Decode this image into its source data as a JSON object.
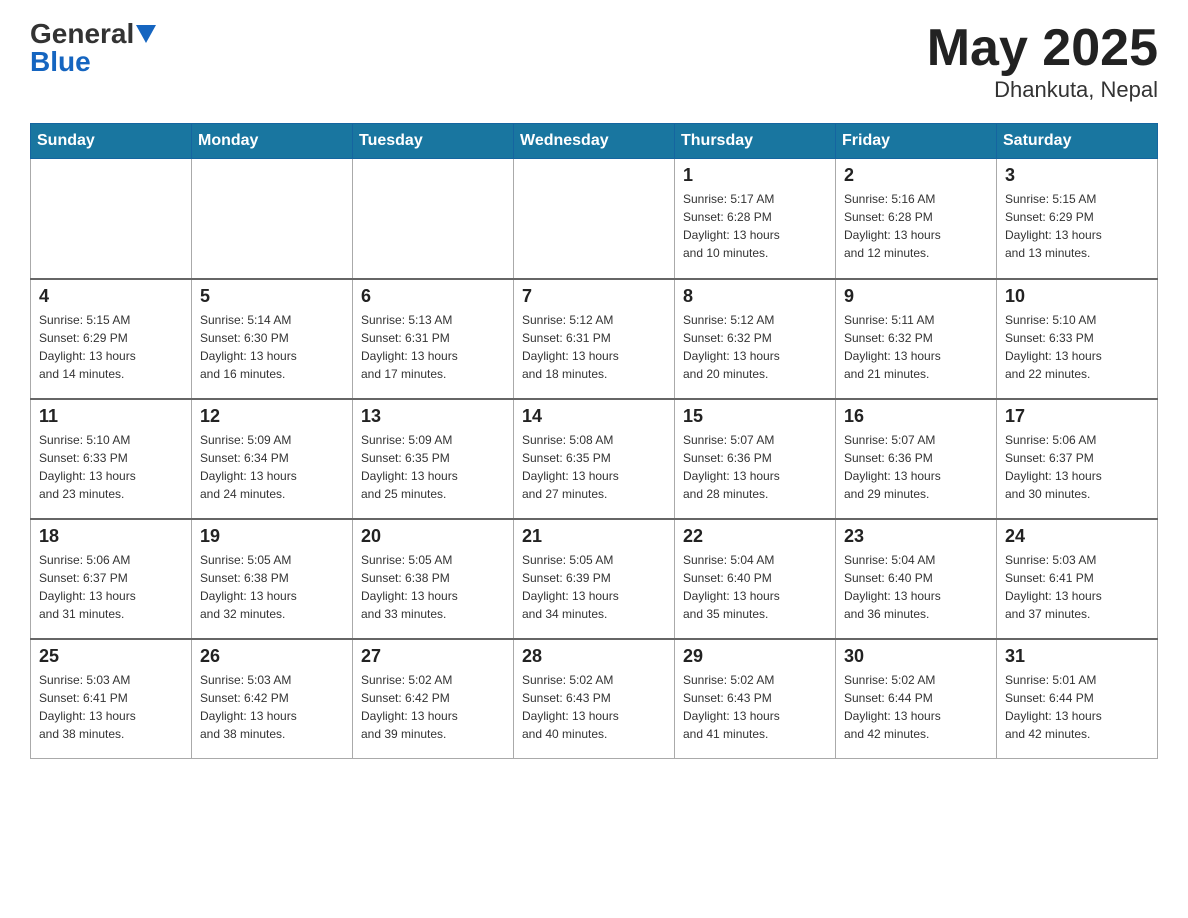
{
  "header": {
    "logo_general": "General",
    "logo_blue": "Blue",
    "month_year": "May 2025",
    "location": "Dhankuta, Nepal"
  },
  "weekdays": [
    "Sunday",
    "Monday",
    "Tuesday",
    "Wednesday",
    "Thursday",
    "Friday",
    "Saturday"
  ],
  "weeks": [
    [
      {
        "day": "",
        "info": ""
      },
      {
        "day": "",
        "info": ""
      },
      {
        "day": "",
        "info": ""
      },
      {
        "day": "",
        "info": ""
      },
      {
        "day": "1",
        "info": "Sunrise: 5:17 AM\nSunset: 6:28 PM\nDaylight: 13 hours\nand 10 minutes."
      },
      {
        "day": "2",
        "info": "Sunrise: 5:16 AM\nSunset: 6:28 PM\nDaylight: 13 hours\nand 12 minutes."
      },
      {
        "day": "3",
        "info": "Sunrise: 5:15 AM\nSunset: 6:29 PM\nDaylight: 13 hours\nand 13 minutes."
      }
    ],
    [
      {
        "day": "4",
        "info": "Sunrise: 5:15 AM\nSunset: 6:29 PM\nDaylight: 13 hours\nand 14 minutes."
      },
      {
        "day": "5",
        "info": "Sunrise: 5:14 AM\nSunset: 6:30 PM\nDaylight: 13 hours\nand 16 minutes."
      },
      {
        "day": "6",
        "info": "Sunrise: 5:13 AM\nSunset: 6:31 PM\nDaylight: 13 hours\nand 17 minutes."
      },
      {
        "day": "7",
        "info": "Sunrise: 5:12 AM\nSunset: 6:31 PM\nDaylight: 13 hours\nand 18 minutes."
      },
      {
        "day": "8",
        "info": "Sunrise: 5:12 AM\nSunset: 6:32 PM\nDaylight: 13 hours\nand 20 minutes."
      },
      {
        "day": "9",
        "info": "Sunrise: 5:11 AM\nSunset: 6:32 PM\nDaylight: 13 hours\nand 21 minutes."
      },
      {
        "day": "10",
        "info": "Sunrise: 5:10 AM\nSunset: 6:33 PM\nDaylight: 13 hours\nand 22 minutes."
      }
    ],
    [
      {
        "day": "11",
        "info": "Sunrise: 5:10 AM\nSunset: 6:33 PM\nDaylight: 13 hours\nand 23 minutes."
      },
      {
        "day": "12",
        "info": "Sunrise: 5:09 AM\nSunset: 6:34 PM\nDaylight: 13 hours\nand 24 minutes."
      },
      {
        "day": "13",
        "info": "Sunrise: 5:09 AM\nSunset: 6:35 PM\nDaylight: 13 hours\nand 25 minutes."
      },
      {
        "day": "14",
        "info": "Sunrise: 5:08 AM\nSunset: 6:35 PM\nDaylight: 13 hours\nand 27 minutes."
      },
      {
        "day": "15",
        "info": "Sunrise: 5:07 AM\nSunset: 6:36 PM\nDaylight: 13 hours\nand 28 minutes."
      },
      {
        "day": "16",
        "info": "Sunrise: 5:07 AM\nSunset: 6:36 PM\nDaylight: 13 hours\nand 29 minutes."
      },
      {
        "day": "17",
        "info": "Sunrise: 5:06 AM\nSunset: 6:37 PM\nDaylight: 13 hours\nand 30 minutes."
      }
    ],
    [
      {
        "day": "18",
        "info": "Sunrise: 5:06 AM\nSunset: 6:37 PM\nDaylight: 13 hours\nand 31 minutes."
      },
      {
        "day": "19",
        "info": "Sunrise: 5:05 AM\nSunset: 6:38 PM\nDaylight: 13 hours\nand 32 minutes."
      },
      {
        "day": "20",
        "info": "Sunrise: 5:05 AM\nSunset: 6:38 PM\nDaylight: 13 hours\nand 33 minutes."
      },
      {
        "day": "21",
        "info": "Sunrise: 5:05 AM\nSunset: 6:39 PM\nDaylight: 13 hours\nand 34 minutes."
      },
      {
        "day": "22",
        "info": "Sunrise: 5:04 AM\nSunset: 6:40 PM\nDaylight: 13 hours\nand 35 minutes."
      },
      {
        "day": "23",
        "info": "Sunrise: 5:04 AM\nSunset: 6:40 PM\nDaylight: 13 hours\nand 36 minutes."
      },
      {
        "day": "24",
        "info": "Sunrise: 5:03 AM\nSunset: 6:41 PM\nDaylight: 13 hours\nand 37 minutes."
      }
    ],
    [
      {
        "day": "25",
        "info": "Sunrise: 5:03 AM\nSunset: 6:41 PM\nDaylight: 13 hours\nand 38 minutes."
      },
      {
        "day": "26",
        "info": "Sunrise: 5:03 AM\nSunset: 6:42 PM\nDaylight: 13 hours\nand 38 minutes."
      },
      {
        "day": "27",
        "info": "Sunrise: 5:02 AM\nSunset: 6:42 PM\nDaylight: 13 hours\nand 39 minutes."
      },
      {
        "day": "28",
        "info": "Sunrise: 5:02 AM\nSunset: 6:43 PM\nDaylight: 13 hours\nand 40 minutes."
      },
      {
        "day": "29",
        "info": "Sunrise: 5:02 AM\nSunset: 6:43 PM\nDaylight: 13 hours\nand 41 minutes."
      },
      {
        "day": "30",
        "info": "Sunrise: 5:02 AM\nSunset: 6:44 PM\nDaylight: 13 hours\nand 42 minutes."
      },
      {
        "day": "31",
        "info": "Sunrise: 5:01 AM\nSunset: 6:44 PM\nDaylight: 13 hours\nand 42 minutes."
      }
    ]
  ]
}
